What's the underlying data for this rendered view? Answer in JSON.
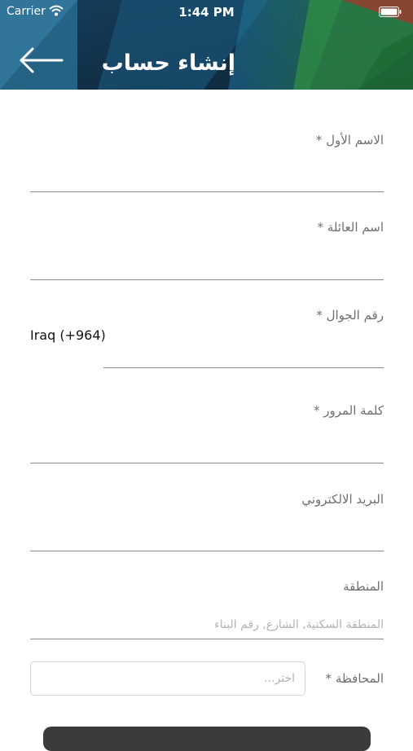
{
  "status_bar": {
    "carrier": "Carrier",
    "time": "1:44 PM"
  },
  "header": {
    "title": "إنشاء حساب",
    "back_icon": "arrow-left-icon"
  },
  "form": {
    "first_name": {
      "label": "الاسم الأول *",
      "value": ""
    },
    "family_name": {
      "label": "اسم العائلة *",
      "value": ""
    },
    "phone": {
      "label": "رقم الجوال *",
      "country_code": "Iraq (+964)",
      "value": ""
    },
    "password": {
      "label": "كلمة المرور *",
      "value": ""
    },
    "email": {
      "label": "البريد الالكتروني",
      "value": ""
    },
    "area": {
      "label": "المنطقة",
      "placeholder": "المنطقة السكنية, الشارع, رقم البناء"
    },
    "governorate": {
      "label": "المحافظة *",
      "placeholder": "اختر..."
    }
  },
  "colors": {
    "header_bg": "#12324a",
    "label": "#6f6f6f",
    "underline": "#8a8a8a",
    "placeholder": "#b3b3b3",
    "button": "#3b3b3b"
  }
}
